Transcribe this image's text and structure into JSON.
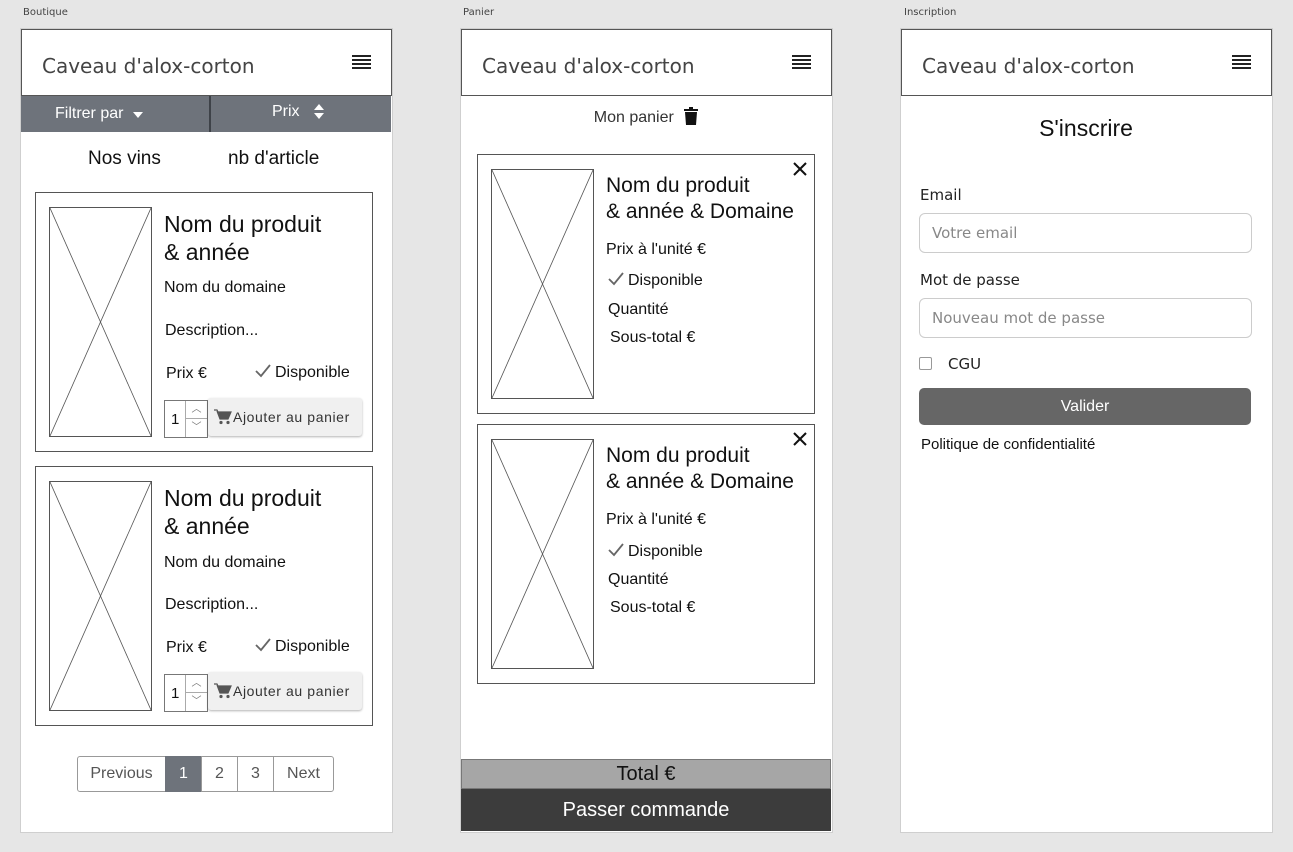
{
  "artboards": {
    "boutique": "Boutique",
    "panier": "Panier",
    "inscription": "Inscription"
  },
  "brand": "Caveau d'alox-corton",
  "icons": [
    "menu-icon",
    "caret-down-icon",
    "sort-icon",
    "check-icon",
    "cart-icon",
    "trash-icon",
    "close-icon",
    "image-placeholder-icon"
  ],
  "boutique": {
    "filter_label": "Filtrer par",
    "sort_label": "Prix",
    "section_title": "Nos vins",
    "count_label": "nb d'article",
    "products": [
      {
        "name_line1": "Nom du produit",
        "name_line2": "& année",
        "domain": "Nom du domaine",
        "description": "Description...",
        "price": "Prix €",
        "availability": "Disponible",
        "quantity": "1",
        "add_to_cart": "Ajouter au panier"
      },
      {
        "name_line1": "Nom du produit",
        "name_line2": "& année",
        "domain": "Nom du domaine",
        "description": "Description...",
        "price": "Prix €",
        "availability": "Disponible",
        "quantity": "1",
        "add_to_cart": "Ajouter au panier"
      }
    ],
    "pagination": {
      "previous": "Previous",
      "pages": [
        "1",
        "2",
        "3"
      ],
      "active_page": "1",
      "next": "Next"
    }
  },
  "panier": {
    "title": "Mon panier",
    "items": [
      {
        "name_line1": "Nom du produit",
        "name_line2": "& année & Domaine",
        "unit_price": "Prix à l'unité €",
        "availability": "Disponible",
        "quantity": "Quantité",
        "subtotal": "Sous-total €"
      },
      {
        "name_line1": "Nom du produit",
        "name_line2": "& année & Domaine",
        "unit_price": "Prix à l'unité €",
        "availability": "Disponible",
        "quantity": "Quantité",
        "subtotal": "Sous-total €"
      }
    ],
    "total": "Total €",
    "checkout": "Passer commande"
  },
  "inscription": {
    "title": "S'inscrire",
    "email_label": "Email",
    "email_placeholder": "Votre email",
    "password_label": "Mot de passe",
    "password_placeholder": "Nouveau mot de passe",
    "terms_label": "CGU",
    "terms_checked": false,
    "submit": "Valider",
    "privacy_link": "Politique de confidentialité"
  }
}
